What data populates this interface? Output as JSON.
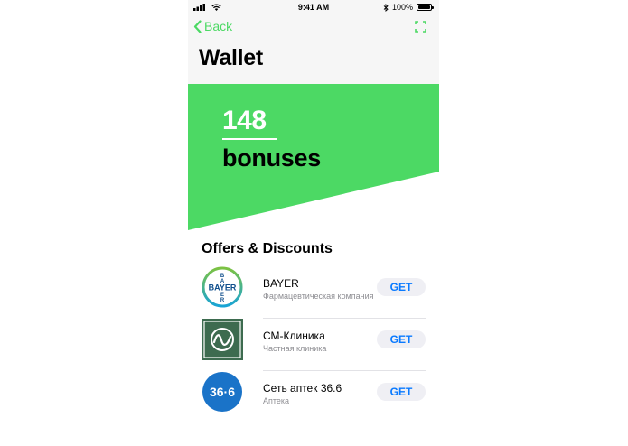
{
  "status_bar": {
    "time": "9:41 AM",
    "battery": "100%"
  },
  "nav": {
    "back_label": "Back"
  },
  "page": {
    "title": "Wallet"
  },
  "hero": {
    "count": "148",
    "label": "bonuses",
    "accent_color": "#4cd964"
  },
  "offers_section": {
    "title": "Offers & Discounts",
    "items": [
      {
        "name": "BAYER",
        "subtitle": "Фармацевтическая компания",
        "logo_text": "BAYER",
        "button": "GET"
      },
      {
        "name": "СМ-Клиника",
        "subtitle": "Частная клиника",
        "logo_text": "",
        "button": "GET"
      },
      {
        "name": "Сеть аптек 36.6",
        "subtitle": "Аптека",
        "logo_text": "36·6",
        "button": "GET"
      }
    ]
  },
  "colors": {
    "accent": "#4cd964",
    "link_blue": "#0a7aff",
    "bayer_blue": "#0f4e8c",
    "clinic_green": "#3d6b4f",
    "pharmacy_blue": "#1a73c8"
  }
}
